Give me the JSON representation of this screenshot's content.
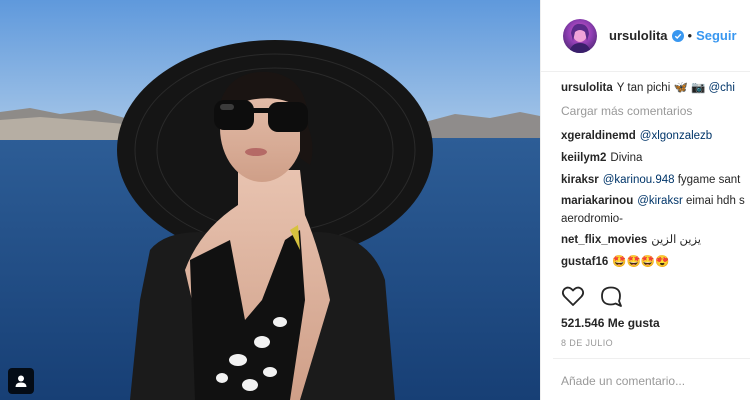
{
  "post": {
    "username": "ursulolita",
    "follow_label": "Seguir",
    "dot": "•"
  },
  "comments": {
    "caption_user": "ursulolita",
    "caption_text": "Y tan pichi 🦋 📷",
    "caption_mention": "@chi",
    "load_more": "Cargar más comentarios",
    "items": [
      {
        "user": "xgeraldinemd",
        "mention": "@xlgonzalezb",
        "text": ""
      },
      {
        "user": "keiilym2",
        "mention": "",
        "text": "Divina"
      },
      {
        "user": "kiraksr",
        "mention": "@karinou.948",
        "text": "fygame sant"
      },
      {
        "user": "mariakarinou",
        "mention": "@kiraksr",
        "text": "eimai hdh s aerodromio-"
      },
      {
        "user": "net_flix_movies",
        "mention": "",
        "text": "يزين الزين"
      },
      {
        "user": "gustaf16",
        "mention": "",
        "text": "🤩🤩🤩😍"
      }
    ]
  },
  "stats": {
    "likes": "521.546 Me gusta",
    "date": "8 DE JULIO"
  },
  "add_comment": {
    "placeholder": "Añade un comentario..."
  },
  "colors": {
    "accent": "#3897f0",
    "verified": "#3897f0",
    "mention": "#003569"
  }
}
